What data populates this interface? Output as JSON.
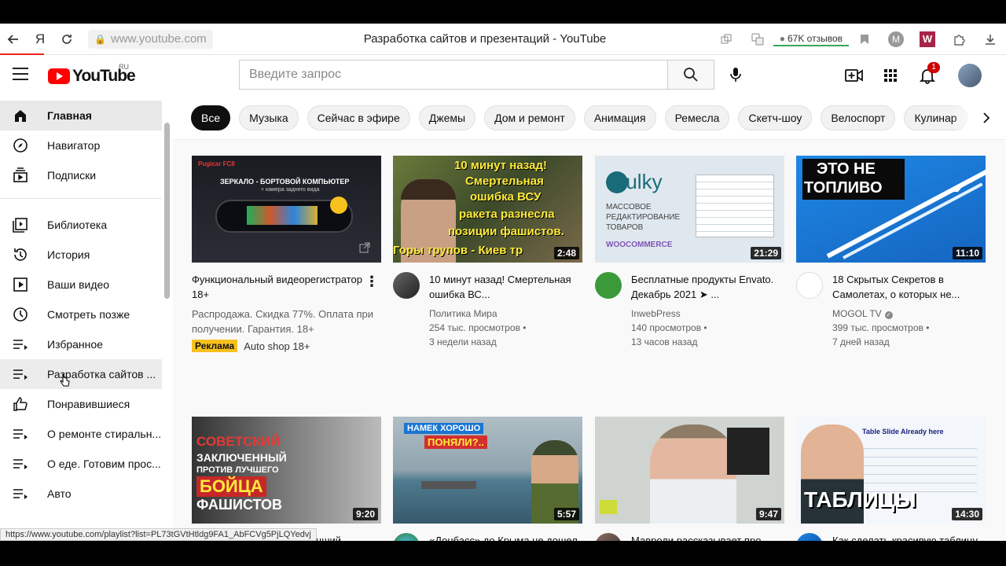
{
  "browser": {
    "url": "www.youtube.com",
    "page_title": "Разработка сайтов и презентаций - YouTube",
    "reviews": "67K отзывов",
    "ext_m": "M",
    "ext_w": "W"
  },
  "header": {
    "logo_text": "YouTube",
    "logo_region": "RU",
    "search_placeholder": "Введите запрос",
    "notification_count": "1"
  },
  "sidebar": {
    "items": [
      {
        "label": "Главная",
        "icon": "home-icon"
      },
      {
        "label": "Навигатор",
        "icon": "compass-icon"
      },
      {
        "label": "Подписки",
        "icon": "subscriptions-icon"
      },
      {
        "label": "Библиотека",
        "icon": "library-icon"
      },
      {
        "label": "История",
        "icon": "history-icon"
      },
      {
        "label": "Ваши видео",
        "icon": "your-videos-icon"
      },
      {
        "label": "Смотреть позже",
        "icon": "clock-icon"
      },
      {
        "label": "Избранное",
        "icon": "playlist-icon"
      },
      {
        "label": "Разработка сайтов ...",
        "icon": "playlist-icon"
      },
      {
        "label": "Понравившиеся",
        "icon": "thumb-up-icon"
      },
      {
        "label": "О ремонте стиральн...",
        "icon": "playlist-icon"
      },
      {
        "label": "О еде. Готовим прос...",
        "icon": "playlist-icon"
      },
      {
        "label": "Авто",
        "icon": "playlist-icon"
      }
    ]
  },
  "chips": [
    "Все",
    "Музыка",
    "Сейчас в эфире",
    "Джемы",
    "Дом и ремонт",
    "Анимация",
    "Ремесла",
    "Скетч-шоу",
    "Велоспорт",
    "Кулинар"
  ],
  "videos_row1": [
    {
      "title": "Функциональный видеорегистратор 18+",
      "ad_desc": "Распродажа. Скидка 77%. Оплата при получении. Гарантия. 18+",
      "ad_badge": "Реклама",
      "ad_channel": "Auto shop 18+",
      "thumb_lines": [
        "ЗЕРКАЛО - БОРТОВОЙ КОМПЬЮТЕР",
        "+ камера заднего вида"
      ],
      "thumb_brand": "Pugicar FC8"
    },
    {
      "title": "10 минут назад! Смертельная ошибка ВС...",
      "channel": "Политика Мира",
      "views": "254 тыс. просмотров",
      "age": "3 недели назад",
      "duration": "2:48",
      "thumb_lines": [
        "10 минут назад!",
        "Смертельная",
        "ошибка ВСУ",
        "ракета разнесла",
        "позиции фашистов.",
        "Горы трупов - Киев тр"
      ]
    },
    {
      "title": "Бесплатные продукты Envato. Декабрь 2021 ➤ ...",
      "channel": "InwebPress",
      "views": "140 просмотров",
      "age": "13 часов назад",
      "duration": "21:29",
      "thumb_lines": [
        "Bulky",
        "МАССОВОЕ",
        "РЕДАКТИРОВАНИЕ",
        "ТОВАРОВ",
        "WOOCOMMERCE"
      ]
    },
    {
      "title": "18 Скрытых Секретов в Самолетах, о которых не...",
      "channel": "MOGOL TV",
      "views": "399 тыс. просмотров",
      "age": "7 дней назад",
      "duration": "11:10",
      "thumb_lines": [
        "ЭТО НЕ",
        "ТОПЛИВО"
      ]
    }
  ],
  "videos_row2": [
    {
      "title": "БОЙ СМЕРТИ - Лучший ...",
      "duration": "9:20",
      "thumb_lines": [
        "СОВЕТСКИЙ",
        "ЗАКЛЮЧЕННЫЙ",
        "ПРОТИВ ЛУЧШЕГО",
        "БОЙЦА",
        "ФАШИСТОВ"
      ]
    },
    {
      "title": "«Донбасс» до Крыма не дошел - Украина дала...",
      "duration": "5:57",
      "thumb_lines": [
        "НАМЕК ХОРОШО",
        "ПОНЯЛИ?.."
      ]
    },
    {
      "title": "Мавроди рассказывает про биткоин",
      "duration": "9:47",
      "thumb_lines": []
    },
    {
      "title": "Как сделать красивую таблицу в PowerPoint в...",
      "duration": "14:30",
      "thumb_lines": [
        "Table Slide Already here",
        "ТАБЛИЦЫ"
      ]
    }
  ],
  "status_url": "https://www.youtube.com/playlist?list=PL73tGVtHtldg9FA1_AbFCVg5PjLQYedvj",
  "colors": {
    "brand_red": "#ff0000",
    "chip_selected": "#0f0f0f",
    "ad_badge": "#f7c11e"
  }
}
